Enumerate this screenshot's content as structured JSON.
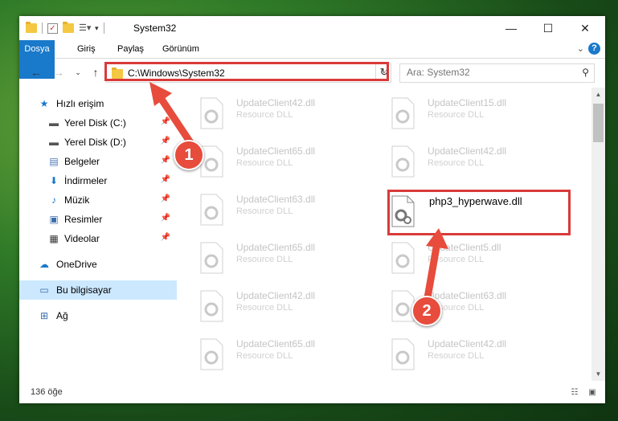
{
  "window": {
    "title": "System32",
    "minimize_icon": "minimize-icon",
    "maximize_icon": "maximize-icon",
    "close_icon": "close-icon"
  },
  "ribbon": {
    "tabs": [
      {
        "label": "Dosya"
      },
      {
        "label": "Giriş"
      },
      {
        "label": "Paylaş"
      },
      {
        "label": "Görünüm"
      }
    ],
    "accent": "#1979ca"
  },
  "navigation": {
    "address_path": "C:\\Windows\\System32",
    "search_placeholder": "Ara: System32"
  },
  "sidebar": {
    "quick_access": "Hızlı erişim",
    "items": [
      {
        "label": "Yerel Disk (C:)",
        "icon": "drive-icon"
      },
      {
        "label": "Yerel Disk (D:)",
        "icon": "drive-icon"
      },
      {
        "label": "Belgeler",
        "icon": "documents-icon"
      },
      {
        "label": "İndirmeler",
        "icon": "download-icon"
      },
      {
        "label": "Müzik",
        "icon": "music-icon"
      },
      {
        "label": "Resimler",
        "icon": "pictures-icon"
      },
      {
        "label": "Videolar",
        "icon": "video-icon"
      }
    ],
    "onedrive": "OneDrive",
    "this_pc": "Bu bilgisayar",
    "network": "Ağ"
  },
  "files": {
    "left_column": [
      {
        "name": "UpdateClient42.dll",
        "type": "Resource DLL"
      },
      {
        "name": "UpdateClient65.dll",
        "type": "Resource DLL"
      },
      {
        "name": "UpdateClient63.dll",
        "type": "Resource DLL"
      },
      {
        "name": "UpdateClient65.dll",
        "type": "Resource DLL"
      },
      {
        "name": "UpdateClient42.dll",
        "type": "Resource DLL"
      },
      {
        "name": "UpdateClient65.dll",
        "type": "Resource DLL"
      }
    ],
    "right_column": [
      {
        "name": "UpdateClient15.dll",
        "type": "Resource DLL"
      },
      {
        "name": "UpdateClient42.dll",
        "type": "Resource DLL"
      },
      {
        "name": "php3_hyperwave.dll",
        "type": ""
      },
      {
        "name": "UpdateClient5.dll",
        "type": "Resource DLL"
      },
      {
        "name": "UpdateClient63.dll",
        "type": "Resource DLL"
      },
      {
        "name": "UpdateClient42.dll",
        "type": "Resource DLL"
      }
    ]
  },
  "status": {
    "item_count": "136 öğe"
  },
  "annotations": {
    "step1": "1",
    "step2": "2",
    "highlight_color": "#d93a3a"
  }
}
